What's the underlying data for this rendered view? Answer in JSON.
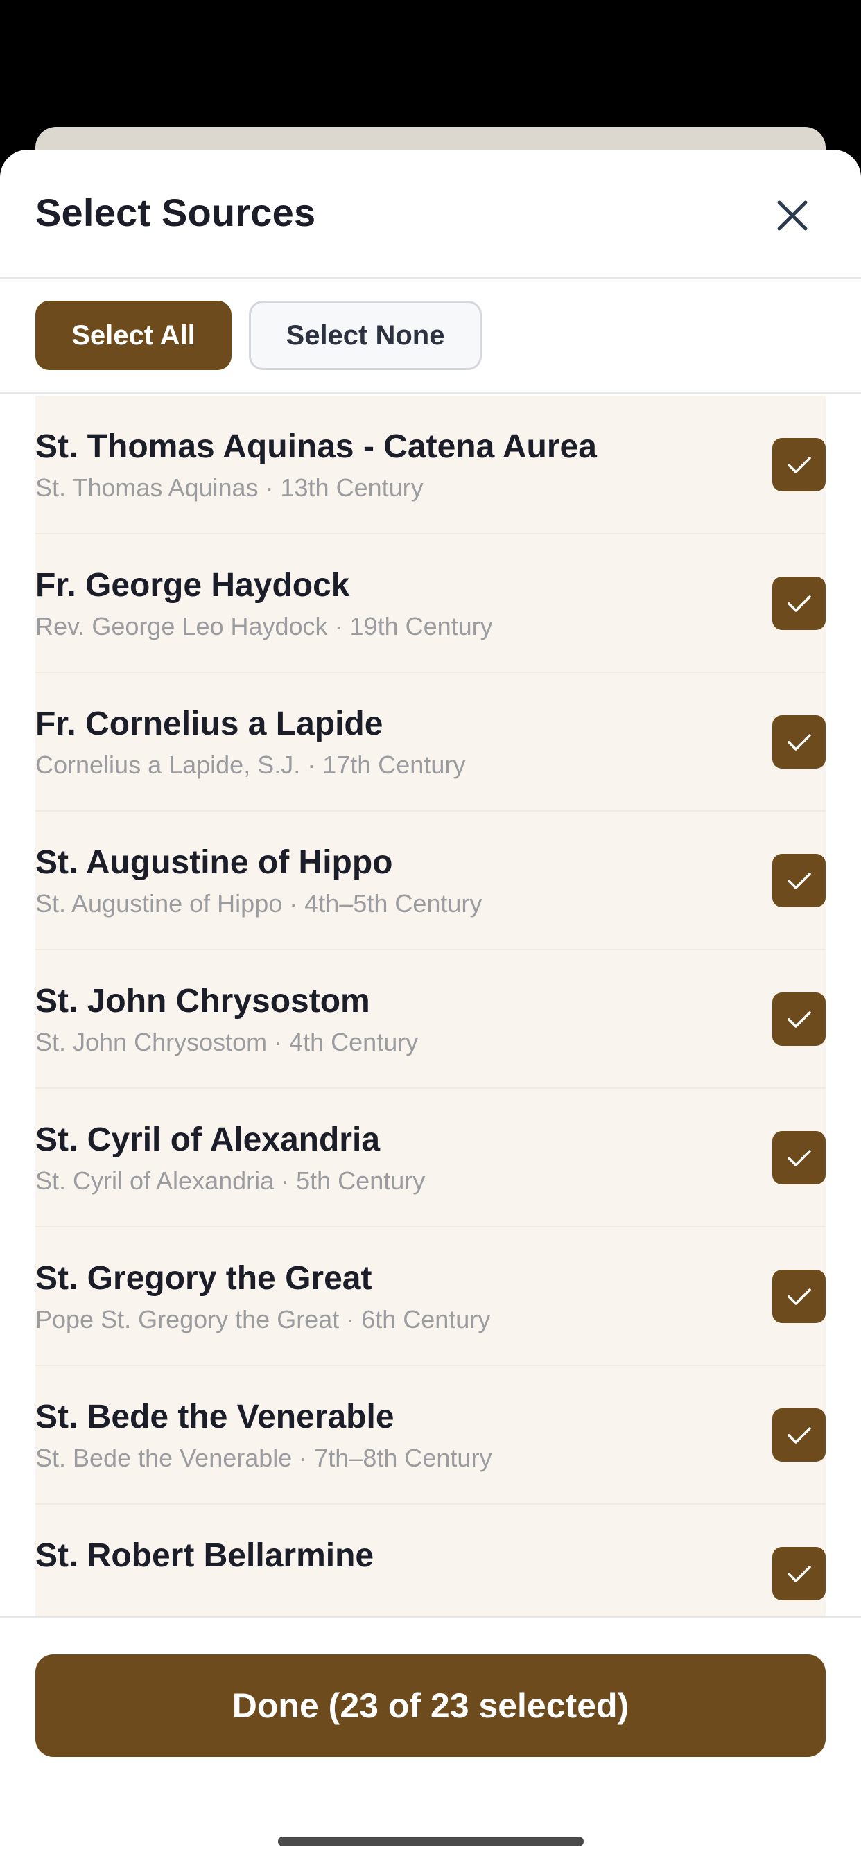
{
  "sheet": {
    "title": "Select Sources",
    "close_icon": "close-icon"
  },
  "toolbar": {
    "select_all_label": "Select All",
    "select_none_label": "Select None"
  },
  "sources": [
    {
      "name": "St. Thomas Aquinas - Catena Aurea",
      "detail": "St. Thomas Aquinas · 13th Century",
      "checked": true
    },
    {
      "name": "Fr. George Haydock",
      "detail": "Rev. George Leo Haydock · 19th Century",
      "checked": true
    },
    {
      "name": "Fr. Cornelius a Lapide",
      "detail": "Cornelius a Lapide, S.J. · 17th Century",
      "checked": true
    },
    {
      "name": "St. Augustine of Hippo",
      "detail": "St. Augustine of Hippo · 4th–5th Century",
      "checked": true
    },
    {
      "name": "St. John Chrysostom",
      "detail": "St. John Chrysostom · 4th Century",
      "checked": true
    },
    {
      "name": "St. Cyril of Alexandria",
      "detail": "St. Cyril of Alexandria · 5th Century",
      "checked": true
    },
    {
      "name": "St. Gregory the Great",
      "detail": "Pope St. Gregory the Great · 6th Century",
      "checked": true
    },
    {
      "name": "St. Bede the Venerable",
      "detail": "St. Bede the Venerable · 7th–8th Century",
      "checked": true
    },
    {
      "name": "St. Robert Bellarmine",
      "detail": "",
      "checked": true
    }
  ],
  "footer": {
    "done_label": "Done (23 of 23 selected)"
  },
  "colors": {
    "accent": "#6d4b1c",
    "row_background": "#f9f4ee",
    "title_text": "#1b1d28",
    "secondary_text": "#9b9c9f"
  }
}
